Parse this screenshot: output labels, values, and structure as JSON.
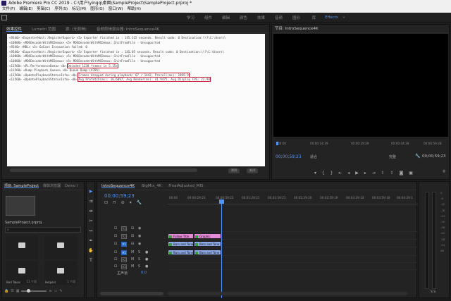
{
  "titlebar": {
    "title": "Adobe Premiere Pro CC 2019 - C:\\用户\\yingq\\桌面\\SampleProject\\SampleProject.prproj *"
  },
  "menubar": {
    "items": [
      "文件(F)",
      "编辑(E)",
      "剪辑(C)",
      "序列(S)",
      "标记(M)",
      "图形(G)",
      "窗口(W)",
      "帮助(H)"
    ]
  },
  "workspace": {
    "tabs": [
      "学习",
      "组件",
      "编辑",
      "颜色",
      "效果",
      "音频",
      "图形",
      "库",
      "Effects"
    ],
    "active": "Effects",
    "more": "»"
  },
  "source_panel": {
    "tabs": [
      "效果控件",
      "Lumetri 范围",
      "源: (无剪辑)",
      "音频剪辑混合器: IntroSequence4K"
    ],
    "active_tab": "效果控件",
    "console_lines": [
      "<9340> <ExporterHost::RegisterExport> <5> Exporter finished in : 145.315 seconds. Result code: 0 Destination:\\\\?\\C:\\Users\\",
      "<10808> <MDSDecoderWithMCDemux> <5> MDSDecoderWithMCDemux::InitFromFile - Unsupported",
      "<9340> <MDL> <5> GoCast Invocation failed: 0",
      "<9340> <ExporterHost::RegisterExport> <5> Exporter finished in : 145.05 seconds. Result code: 0 Destination:\\\\?\\C:\\Users\\",
      "<10808> <MDSDecoderWithMCDemux> <5> MDSDecoderWithMCDemux::InitFromFile - Unsupported",
      "<10808> <MDSDecoderWithMCDemux> <5> MDSDecoderWithMCDemux::InitFromFile - Unsupported",
      "<11560> <PL.PerformanceData> <0> ",
      "<11560> <Dump Playback Queue> <0> ",
      "<11560> <UpdatePlaybackStatusInfo> <0> ",
      "<11560> <UpdatePlaybackStatusInfo> <0> "
    ],
    "hl_perf": "Decoded 1238 frames in 5.15s",
    "dump_suffix": "Queue Dump (4785)",
    "hl_dropped": "Frames dropped during playback: 67 / 1442, Preroll(ms): 1899.9",
    "hl_prefetch": "Avg Prefetch(ms): 16.6097, Avg Render(ms): 41.9475, Avg Display FPS: 22.98",
    "btn_clear": "清除",
    "btn_close": "关闭"
  },
  "program_panel": {
    "title": "节目: IntroSequence4K",
    "timecode": "00;00;59;23",
    "fit": "适合",
    "resolution": "完整",
    "duration": "00;00;59;23",
    "ruler": [
      "00:00",
      "00:00:14:29",
      "00:00:29:29",
      "00:00:44:28",
      "00:00:59:28"
    ]
  },
  "project_panel": {
    "tabs": [
      "项目: SampleProject",
      "媒体浏览器",
      "Demo I"
    ],
    "file": "SampleProject.prproj",
    "bins": [
      {
        "label": "",
        "count": ""
      },
      {
        "label": "",
        "count": ""
      },
      {
        "label": "Bed Takes",
        "count": "11 个项"
      },
      {
        "label": "Helpers",
        "count": "1 个项"
      }
    ]
  },
  "timeline_panel": {
    "tabs": [
      "IntroSequence4K",
      "BigMix_4K",
      "FinalAdjusted_MIS"
    ],
    "active_tab": "IntroSequence4K",
    "timecode": "00;00;59;23",
    "ruler": [
      "00:00",
      "00:00:29:23",
      "00:00:59:22",
      "00:01:29:21",
      "00:01:59:21",
      "00:02:29:20",
      "00:02:59:19",
      "00:03:29:18",
      "00:03:59:18",
      "00:04:29:1"
    ],
    "tracks": [
      {
        "name": "V3",
        "type": "V"
      },
      {
        "name": "V2",
        "type": "V"
      },
      {
        "name": "V1",
        "type": "V"
      },
      {
        "name": "A1",
        "type": "A"
      },
      {
        "name": "A2",
        "type": "A"
      },
      {
        "name": "A3",
        "type": "A"
      }
    ],
    "clips": {
      "v2a": "Follow Title",
      "v2b": "Graphic",
      "v1a": "Bars and Tone",
      "v1b": "Bars and Tone",
      "a1a": "Bars and Tone",
      "a1b": "Bars and Tone"
    },
    "master_label": "主声道",
    "master_value": "0.0"
  },
  "meters": {
    "scale": [
      "0",
      "-6",
      "-12",
      "-18",
      "-24",
      "-30",
      "-36",
      "-42",
      "-48",
      "-54",
      "dB"
    ],
    "solo": "S S"
  },
  "colors": {
    "accent": "#4f95ff",
    "highlight_box": "#c8102e",
    "clip_pink": "#e58ad8",
    "clip_blue": "#8da9e6"
  }
}
